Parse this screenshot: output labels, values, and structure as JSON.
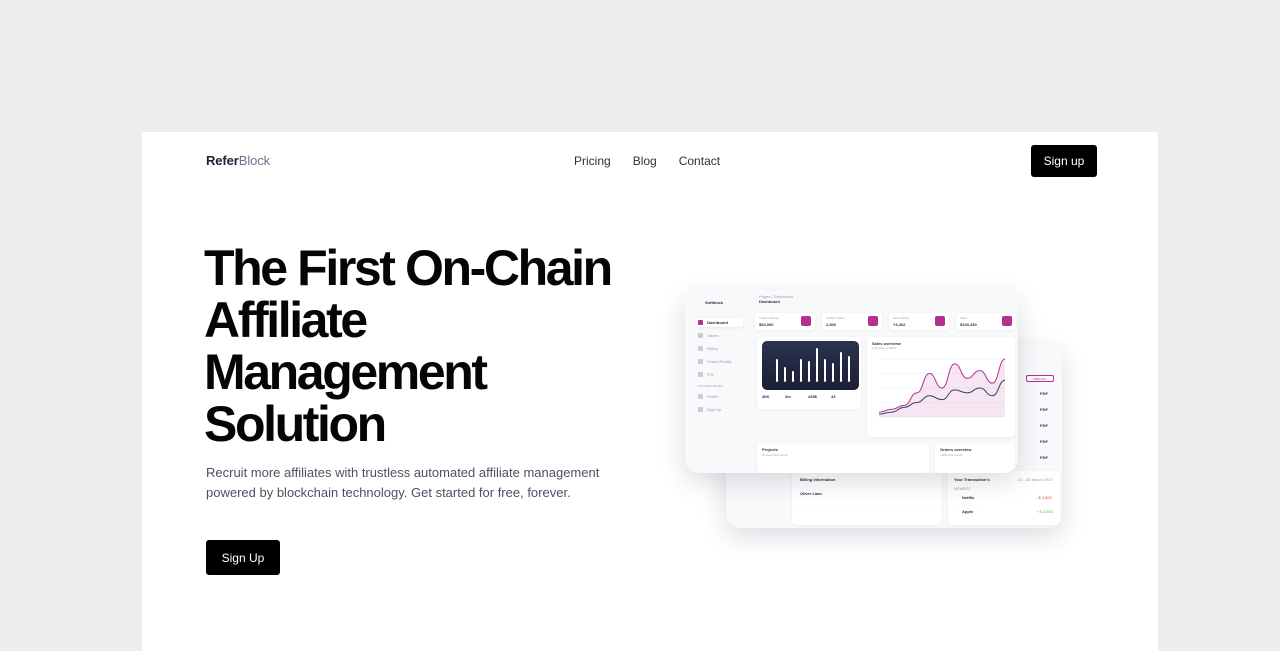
{
  "brand": {
    "part1": "Refer",
    "part2": "Block"
  },
  "nav": {
    "items": [
      "Pricing",
      "Blog",
      "Contact"
    ],
    "signup": "Sign up"
  },
  "hero": {
    "title": "The First On-Chain Affiliate Management Solution",
    "subtitle": "Recruit more affiliates with trustless automated affiliate management powered by blockchain technology. Get started for free, forever.",
    "cta": "Sign Up"
  },
  "mockup": {
    "front": {
      "sidebar_title": "Softblock",
      "breadcrumb": "Pages / Dashboard",
      "page_title": "Dashboard",
      "sidebar": [
        "Dashboard",
        "Tables",
        "Billing",
        "Virtual Reality",
        "RTL",
        "ACCOUNT PAGES",
        "Profile",
        "Sign Up"
      ],
      "stats": [
        {
          "label": "Today's Money",
          "value": "$53,000",
          "delta": "+55%"
        },
        {
          "label": "Today's Users",
          "value": "2,300",
          "delta": "+3%"
        },
        {
          "label": "New Clients",
          "value": "+3,462",
          "delta": "-2%"
        },
        {
          "label": "Sales",
          "value": "$103,430",
          "delta": "+5%"
        }
      ],
      "bar_chart": {
        "values": [
          30,
          20,
          15,
          30,
          28,
          45,
          30,
          25,
          40,
          35
        ]
      },
      "bar_stats": [
        "36K",
        "2m",
        "435$",
        "43"
      ],
      "sales_overview": {
        "title": "Sales overview",
        "sub": "(+5) more in 2021"
      },
      "line_chart": {
        "series_a": [
          5,
          8,
          12,
          25,
          45,
          30,
          55,
          40,
          48,
          35,
          60
        ],
        "series_b": [
          3,
          5,
          10,
          15,
          22,
          18,
          28,
          25,
          30,
          22,
          38
        ]
      },
      "projects": {
        "title": "Projects",
        "sub": "30 done this month"
      },
      "orders": {
        "title": "Orders overview",
        "sub": "+30% this month"
      }
    },
    "back": {
      "billing_title": "Billing Information",
      "billing_name": "Oliver Liam",
      "transactions_title": "Your Transaction's",
      "transactions_date": "23 - 30 March 2020",
      "newest": "NEWEST",
      "tx": [
        {
          "name": "Netflix",
          "amount": "- $ 2,500"
        },
        {
          "name": "Apple",
          "amount": "+ $ 2,000"
        }
      ],
      "invoices_btn": "VIEW ALL",
      "invoices": [
        "PDF",
        "PDF",
        "PDF",
        "PDF",
        "PDF"
      ]
    }
  }
}
